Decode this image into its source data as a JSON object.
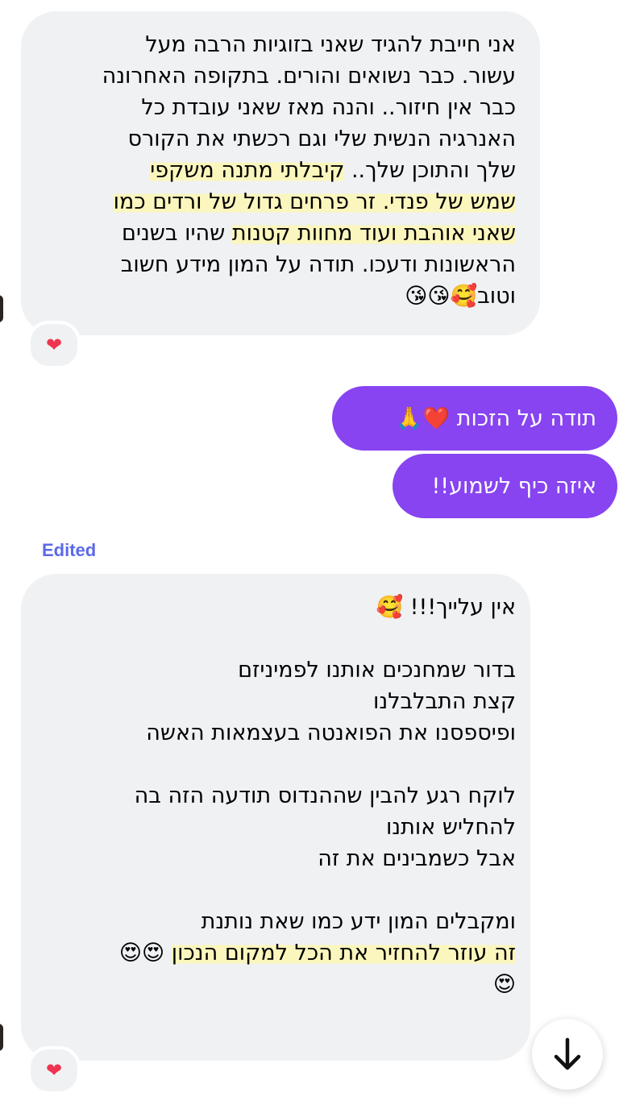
{
  "thread": {
    "msg1": {
      "lines": [
        {
          "parts": [
            {
              "t": "אני חייבת להגיד שאני בזוגיות הרבה מעל",
              "h": false
            }
          ]
        },
        {
          "parts": [
            {
              "t": "עשור. כבר נשואים והורים. בתקופה האחרונה",
              "h": false
            }
          ]
        },
        {
          "parts": [
            {
              "t": "כבר אין חיזור.. והנה מאז שאני עובדת כל",
              "h": false
            }
          ]
        },
        {
          "parts": [
            {
              "t": "האנרגיה הנשית שלי וגם רכשתי את הקורס",
              "h": false
            }
          ]
        },
        {
          "parts": [
            {
              "t": "שלך והתוכן שלך.. ",
              "h": false
            },
            {
              "t": "קיבלתי מתנה משקפי",
              "h": true
            }
          ]
        },
        {
          "parts": [
            {
              "t": "שמש של פנדי. זר פרחים גדול של ורדים כמו",
              "h": true
            }
          ]
        },
        {
          "parts": [
            {
              "t": "שאני אוהבת ועוד מחוות קטנות",
              "h": true
            },
            {
              "t": " שהיו בשנים",
              "h": false
            }
          ]
        },
        {
          "parts": [
            {
              "t": "הראשונות ודעכו. תודה על המון מידע חשוב",
              "h": false
            }
          ]
        },
        {
          "parts": [
            {
              "t": "וטוב🥰😘😘",
              "h": false
            }
          ]
        }
      ],
      "reaction": "❤"
    },
    "out1": "תודה על הזכות ❤️🙏",
    "out2": "איזה כיף לשמוע!!",
    "edited_label": "Edited",
    "msg2": {
      "lines": [
        {
          "parts": [
            {
              "t": "אין עלייך!!! 🥰",
              "h": false
            }
          ]
        },
        {
          "parts": [
            {
              "t": "",
              "h": false
            }
          ]
        },
        {
          "parts": [
            {
              "t": "בדור שמחנכים אותנו לפמיניזם",
              "h": false
            }
          ]
        },
        {
          "parts": [
            {
              "t": "קצת התבלבלנו",
              "h": false
            }
          ]
        },
        {
          "parts": [
            {
              "t": "ופיספסנו את הפואנטה בעצמאות האשה",
              "h": false
            }
          ]
        },
        {
          "parts": [
            {
              "t": "",
              "h": false
            }
          ]
        },
        {
          "parts": [
            {
              "t": "לוקח רגע להבין שההנדוס תודעה הזה בה",
              "h": false
            }
          ]
        },
        {
          "parts": [
            {
              "t": "להחליש אותנו",
              "h": false
            }
          ]
        },
        {
          "parts": [
            {
              "t": "אבל כשמבינים את זה",
              "h": false
            }
          ]
        },
        {
          "parts": [
            {
              "t": "",
              "h": false
            }
          ]
        },
        {
          "parts": [
            {
              "t": "ומקבלים המון ידע כמו שאת נותנת",
              "h": false
            }
          ]
        },
        {
          "parts": [
            {
              "t": "זה עוזר להחזיר את הכל למקום הנכון",
              "h": true
            },
            {
              "t": " 😍😍",
              "h": false
            }
          ]
        },
        {
          "parts": [
            {
              "t": "😍",
              "h": false
            }
          ]
        }
      ],
      "reaction": "❤"
    },
    "scroll_icon": "arrow-down-icon"
  }
}
